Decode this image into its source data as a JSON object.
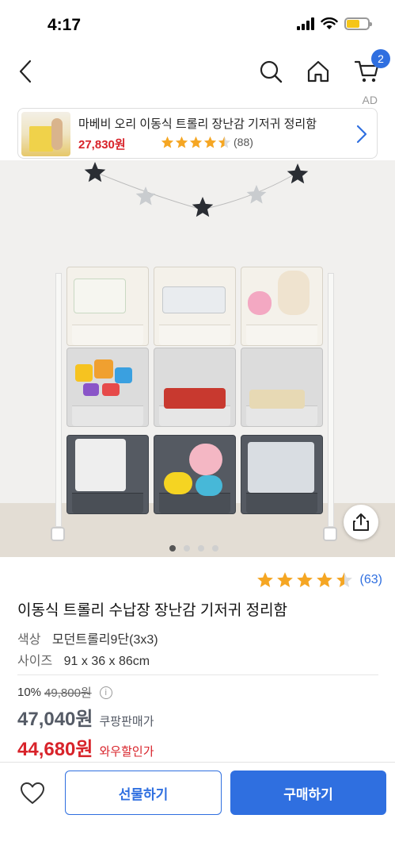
{
  "status_bar": {
    "time": "4:17",
    "battery_color": "#f5c518"
  },
  "nav": {
    "back_icon": "chevron-left-icon",
    "search_icon": "search-icon",
    "home_icon": "home-icon",
    "cart_icon": "cart-icon",
    "cart_badge": "2",
    "accent": "#2f6fe0"
  },
  "ad": {
    "label": "AD",
    "title": "마베비 오리 이동식 트롤리 장난감 기저귀 정리함",
    "price": "27,830원",
    "rating": 4.5,
    "review_count": "(88)"
  },
  "gallery": {
    "image_count": 4,
    "active_index": 0,
    "share_icon": "share-icon"
  },
  "product": {
    "rating": 4.5,
    "review_count": "(63)",
    "title": "이동식 트롤리 수납장 장난감 기저귀 정리함",
    "options": [
      {
        "key": "색상",
        "value": "모던트롤리9단(3x3)"
      },
      {
        "key": "사이즈",
        "value": "91 x 36 x 86cm"
      }
    ],
    "discount_percent": "10%",
    "original_price": "49,800원",
    "info_icon": "i",
    "coupang_price": "47,040원",
    "coupang_price_label": "쿠팡판매가",
    "wow_price": "44,680원",
    "wow_price_label": "와우할인가",
    "price_grey": "#555b66",
    "price_red": "#d8232a"
  },
  "bottom_bar": {
    "wishlist_icon": "heart-icon",
    "gift_label": "선물하기",
    "buy_label": "구매하기"
  }
}
